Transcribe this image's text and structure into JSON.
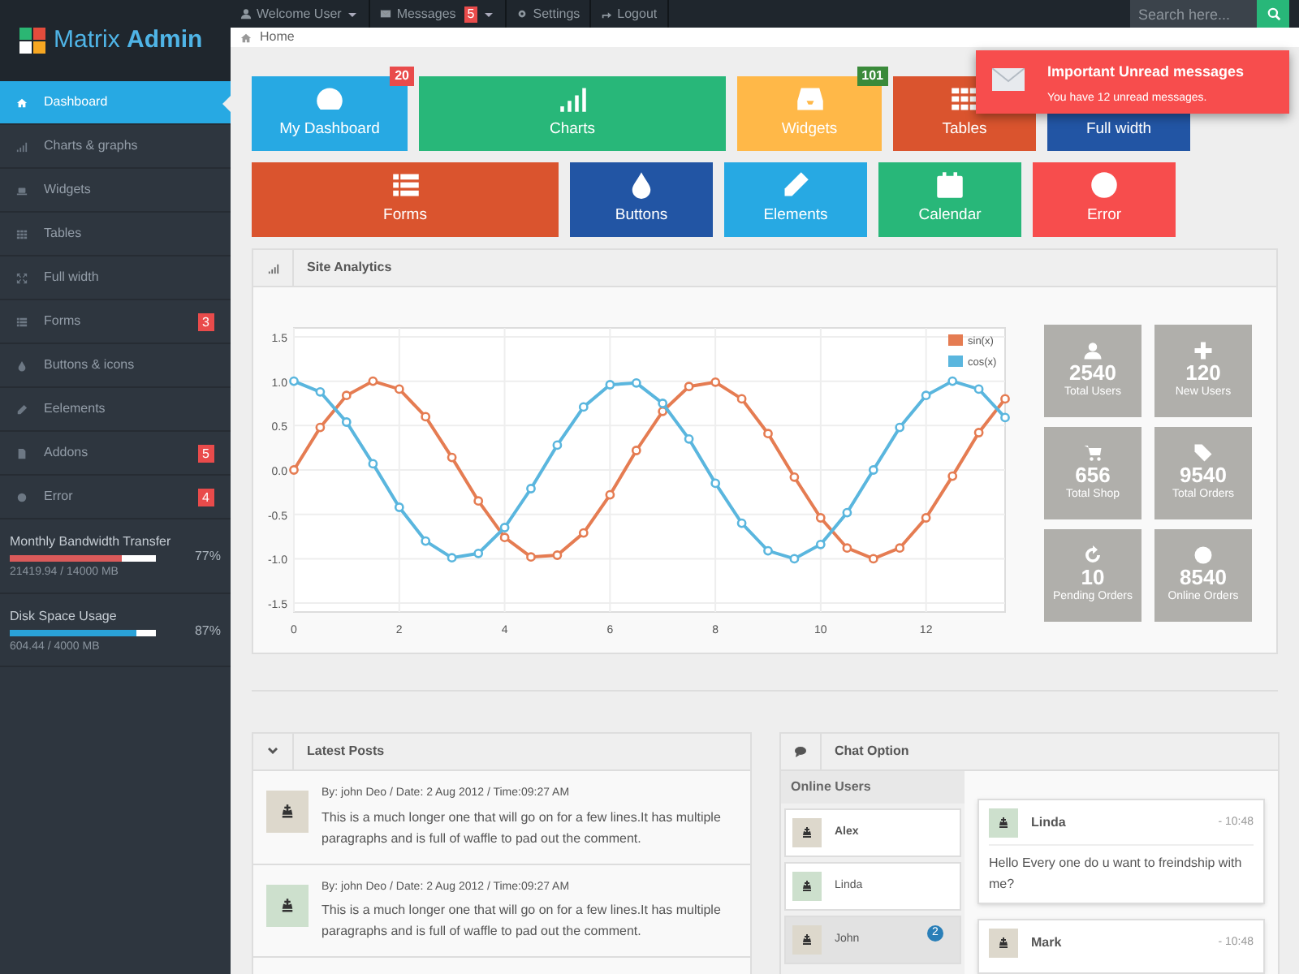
{
  "logo": {
    "text": "Matrix **Admin**"
  },
  "top_nav": [
    {
      "label": "Welcome User",
      "dropdown": true
    },
    {
      "label": "Messages",
      "badge": "5",
      "dropdown": true
    },
    {
      "label": "Settings",
      "dropdown": false
    },
    {
      "label": "Logout",
      "dropdown": false
    }
  ],
  "search": {
    "placeholder": "Search here..."
  },
  "sidebar": {
    "items": [
      {
        "label": "Dashboard",
        "selected": true
      },
      {
        "label": "Charts & graphs",
        "selected": false
      },
      {
        "label": "Widgets",
        "selected": false
      },
      {
        "label": "Tables",
        "selected": false
      },
      {
        "label": "Full width",
        "selected": false
      },
      {
        "label": "Forms",
        "badge": "3",
        "selected": false
      },
      {
        "label": "Buttons & icons",
        "selected": false
      },
      {
        "label": "Eelements",
        "selected": false
      },
      {
        "label": "Addons",
        "badge": "5",
        "selected": false
      },
      {
        "label": "Error",
        "badge": "4",
        "selected": false
      }
    ],
    "stats": [
      {
        "label": "Monthly Bandwidth Transfer",
        "level": 0.77,
        "reading": "21419.94 / 14000 MB",
        "percent": "77%",
        "color": "#da5a5a"
      },
      {
        "label": "Disk Space Usage",
        "level": 0.87,
        "reading": "604.44 / 4000 MB",
        "percent": "87%",
        "color": "#2aa2d8"
      }
    ]
  },
  "breadcrumb": [
    "Home"
  ],
  "notification": {
    "title": "Important Unread messages",
    "text": "You have 12 unread messages."
  },
  "tiles": [
    [
      {
        "label": "My Dashboard",
        "color": "#27a9e3",
        "badge": {
          "text": "20",
          "color": "#e94b4b"
        }
      },
      {
        "label": "Charts",
        "color": "#28b779"
      },
      {
        "label": "Widgets",
        "color": "#ffb848",
        "badge": {
          "text": "101",
          "color": "#3a8a3a"
        }
      },
      {
        "label": "Tables",
        "color": "#da542e"
      },
      {
        "label": "Full width",
        "color": "#2255a4"
      }
    ],
    [
      {
        "label": "Forms",
        "color": "#da542e"
      },
      {
        "label": "Buttons",
        "color": "#2255a4"
      },
      {
        "label": "Elements",
        "color": "#27a9e3"
      },
      {
        "label": "Calendar",
        "color": "#28b779"
      },
      {
        "label": "Error",
        "color": "#f74d4d"
      }
    ]
  ],
  "analytics": {
    "title": "Site Analytics",
    "chart_data": {
      "type": "line",
      "x": [
        0,
        0.5,
        1,
        1.5,
        2,
        2.5,
        3,
        3.5,
        4,
        4.5,
        5,
        5.5,
        6,
        6.5,
        7,
        7.5,
        8,
        8.5,
        9,
        9.5,
        10,
        10.5,
        11,
        11.5,
        12,
        12.5,
        13,
        13.5
      ],
      "series": [
        {
          "name": "sin(x)",
          "color": "#e57c52",
          "marker": "circle",
          "values": [
            0,
            0.48,
            0.84,
            1,
            0.91,
            0.6,
            0.14,
            -0.35,
            -0.76,
            -0.98,
            -0.96,
            -0.71,
            -0.28,
            0.22,
            0.66,
            0.94,
            0.99,
            0.8,
            0.41,
            -0.08,
            -0.54,
            -0.88,
            -1,
            -0.88,
            -0.54,
            -0.07,
            0.42,
            0.8
          ]
        },
        {
          "name": "cos(x)",
          "color": "#5ab6de",
          "marker": "circle",
          "values": [
            1,
            0.88,
            0.54,
            0.07,
            -0.42,
            -0.8,
            -0.99,
            -0.94,
            -0.65,
            -0.21,
            0.28,
            0.71,
            0.96,
            0.98,
            0.75,
            0.35,
            -0.15,
            -0.6,
            -0.91,
            -1,
            -0.84,
            -0.48,
            0,
            0.48,
            0.84,
            1,
            0.91,
            0.59
          ]
        }
      ],
      "grid": true,
      "legend": true,
      "xlim": [
        0,
        13.5
      ],
      "ylim": [
        -1.6,
        1.6
      ],
      "xticks": [
        0,
        2,
        4,
        6,
        8,
        10,
        12
      ],
      "yticks": [
        {
          "value": 1.5,
          "label": "1.5"
        },
        {
          "value": 1,
          "label": "1.0"
        },
        {
          "value": 0.5,
          "label": "0.5"
        },
        {
          "value": 0,
          "label": "0.0"
        },
        {
          "value": -0.5,
          "label": "-0.5"
        },
        {
          "value": -1,
          "label": "-1.0"
        },
        {
          "value": -1.5,
          "label": "-1.5"
        }
      ]
    },
    "stats": [
      {
        "value": "2540",
        "label": "Total Users"
      },
      {
        "value": "120",
        "label": "New Users"
      },
      {
        "value": "656",
        "label": "Total Shop"
      },
      {
        "value": "9540",
        "label": "Total Orders"
      },
      {
        "value": "10",
        "label": "Pending Orders"
      },
      {
        "value": "8540",
        "label": "Online Orders"
      }
    ]
  },
  "latest_posts": {
    "title": "Latest Posts",
    "posts": [
      {
        "meta": "By: john Deo / Date: 2 Aug 2012 / Time:09:27 AM",
        "text": "This is a much longer one that will go on for a few lines.It has multiple paragraphs and is full of waffle to pad out the comment."
      },
      {
        "meta": "By: john Deo / Date: 2 Aug 2012 / Time:09:27 AM",
        "text": "This is a much longer one that will go on for a few lines.It has multiple paragraphs and is full of waffle to pad out the comment."
      }
    ]
  },
  "chat": {
    "title": "Chat Option",
    "online_title": "Online Users",
    "users": [
      {
        "name": "Alex",
        "selected": false
      },
      {
        "name": "Linda",
        "selected": false
      },
      {
        "name": "John",
        "badge": "2",
        "selected": true
      }
    ],
    "messages": [
      {
        "name": "Linda",
        "time": "- 10:48",
        "text": "Hello Every one do u want to freindship with me?"
      },
      {
        "name": "Mark",
        "time": "- 10:48"
      }
    ]
  }
}
